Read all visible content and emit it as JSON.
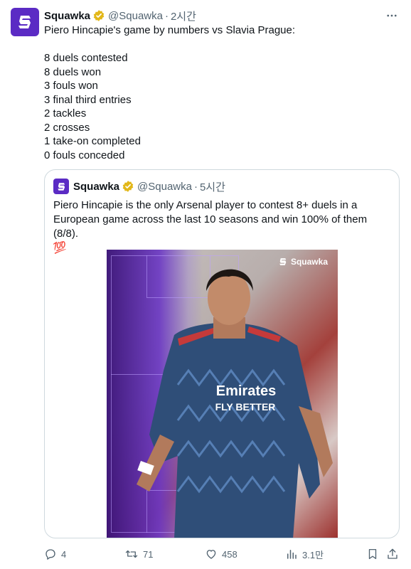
{
  "tweet": {
    "author": {
      "name": "Squawka",
      "handle": "@Squawka",
      "time": "2시간",
      "avatar_icon": "squawka-logo-icon",
      "verified_color": "#e2b719"
    },
    "text_lines": [
      "Piero Hincapie's game by numbers vs Slavia Prague:",
      "",
      "8 duels contested",
      "8 duels won",
      "3 fouls won",
      "3 final third entries",
      "2 tackles",
      "2 crosses",
      "1 take-on completed",
      "0 fouls conceded"
    ]
  },
  "quoted_tweet": {
    "author": {
      "name": "Squawka",
      "handle": "@Squawka",
      "time": "5시간"
    },
    "text_line1": "Piero Hincapie is the only Arsenal player to contest 8+ duels in a",
    "text_line2": "European game across the last 10 seasons and win 100% of them (8/8).",
    "emoji": "💯",
    "image": {
      "brand_label": "Squawka",
      "shirt_sponsor": "Emirates",
      "shirt_sponsor_sub": "FLY BETTER"
    }
  },
  "actions": {
    "replies": "4",
    "reposts": "71",
    "likes": "458",
    "views": "3.1만"
  },
  "colors": {
    "brand_purple": "#5b2bc4",
    "text_primary": "#0f1419",
    "text_secondary": "#536471",
    "border": "#cfd9de"
  }
}
